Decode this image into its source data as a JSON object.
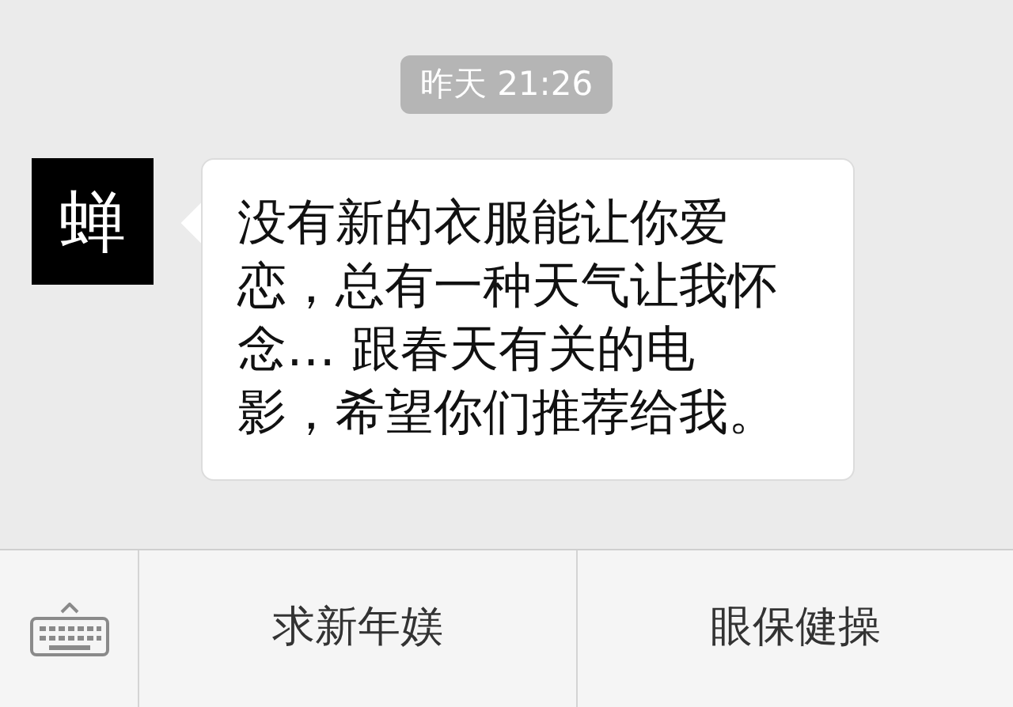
{
  "timestamp": "昨天 21:26",
  "messages": [
    {
      "avatar_text": "蝉",
      "text": "没有新的衣服能让你爱恋，总有一种天气让我怀念… 跟春天有关的电影，希望你们推荐给我。"
    }
  ],
  "menu_buttons": [
    "求新年媄",
    "眼保健操"
  ]
}
